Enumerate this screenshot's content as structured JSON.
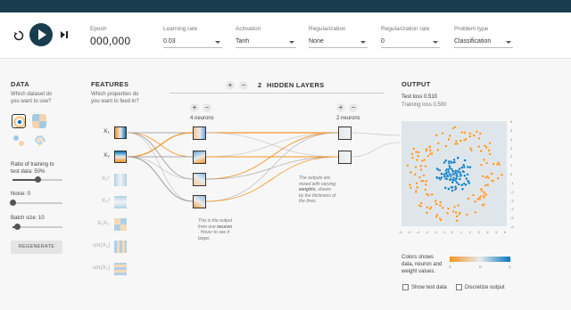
{
  "controls": {
    "epoch_label": "Epoch",
    "epoch_value": "000,000",
    "learning_rate_label": "Learning rate",
    "learning_rate_value": "0.03",
    "activation_label": "Activation",
    "activation_value": "Tanh",
    "regularization_label": "Regularization",
    "regularization_value": "None",
    "reg_rate_label": "Regularization rate",
    "reg_rate_value": "0",
    "problem_label": "Problem type",
    "problem_value": "Classification"
  },
  "data_panel": {
    "title": "DATA",
    "question": [
      "Which dataset do",
      "you want to use?"
    ],
    "ratio_label": [
      "Ratio of training to",
      "test data:  50%"
    ],
    "ratio_value": 0.5,
    "noise_label": "Noise:  0",
    "noise_value": 0,
    "batch_label": "Batch size:  10",
    "batch_value": 0.1,
    "regenerate": "REGENERATE"
  },
  "features_panel": {
    "title": "FEATURES",
    "question": [
      "Which properties do",
      "you want to feed in?"
    ],
    "features": [
      "X₁",
      "X₂",
      "X₁²",
      "X₂²",
      "X₁X₂",
      "sin(X₁)",
      "sin(X₂)"
    ],
    "active": [
      true,
      true,
      false,
      false,
      false,
      false,
      false
    ]
  },
  "hidden": {
    "plus": "+",
    "minus": "−",
    "count": "2",
    "title": "HIDDEN LAYERS",
    "layer1_neurons": "4 neurons",
    "layer2_neurons": "2 neurons",
    "note_neuron": [
      "This is the output",
      "from one ",
      "neuron",
      ". Hover to see it",
      "larger."
    ],
    "note_weights": [
      "The outputs are",
      "mixed with varying",
      "weights",
      ", shown",
      "by the thickness of",
      "the lines."
    ]
  },
  "output": {
    "title": "OUTPUT",
    "test_loss": "Test loss 0.510",
    "training_loss": "Training loss 0.500",
    "axis_ticks": [
      "-6",
      "-5",
      "-4",
      "-3",
      "-2",
      "-1",
      "0",
      "1",
      "2",
      "3",
      "4",
      "5",
      "6"
    ],
    "legend_text": [
      "Colors shows",
      "data, neuron and",
      "weight values."
    ],
    "legend_ticks": [
      "-1",
      "0",
      "1"
    ],
    "show_test": "Show test data",
    "discretize": "Discretize output"
  },
  "colors": {
    "orange": "#f59322",
    "blue": "#0877bd",
    "dark": "#183d4e"
  }
}
